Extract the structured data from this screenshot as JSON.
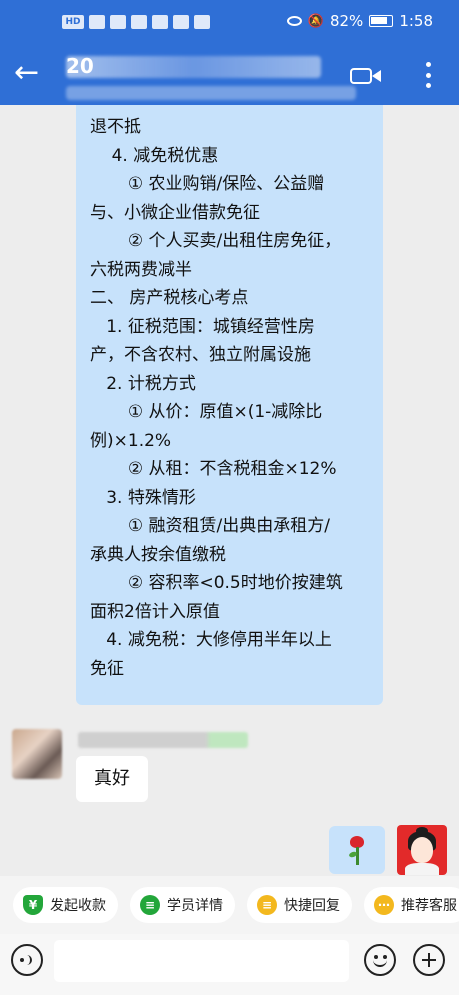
{
  "status_bar": {
    "icons": [
      "HD",
      "signal-icon",
      "mail-icon",
      "app-icon",
      "app-icon",
      "chat-icon",
      "app-icon"
    ],
    "battery": "82%",
    "time": "1:58"
  },
  "header": {
    "title_visible": "20"
  },
  "messages": {
    "long_lines": [
      "退不抵",
      "    4. 减免税优惠",
      "       ① 农业购销/保险、公益赠",
      "与、小微企业借款免征",
      "       ② 个人买卖/出租住房免征，",
      "六税两费减半",
      "二、 房产税核心考点",
      "   1. 征税范围：城镇经营性房",
      "产，不含农村、独立附属设施",
      "   2. 计税方式",
      "       ① 从价：原值×(1-减除比",
      "例)×1.2%",
      "       ② 从租：不含税租金×12%",
      "   3. 特殊情形",
      "       ① 融资租赁/出典由承租方/",
      "承典人按余值缴税",
      "       ② 容积率<0.5时地价按建筑",
      "面积2倍计入原值",
      "   4. 减免税：大修停用半年以上",
      "免征"
    ],
    "reply": "真好"
  },
  "quick_actions": {
    "collect": "发起收款",
    "student": "学员详情",
    "quick_reply": "快捷回复",
    "recommend": "推荐客服"
  }
}
